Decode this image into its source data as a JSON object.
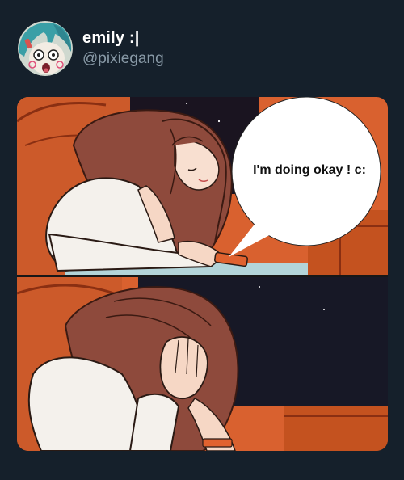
{
  "tweet": {
    "author": {
      "display_name": "emily :|",
      "handle": "@pixiegang",
      "avatar_icon": "shocked-cartoon-avatar-icon"
    },
    "media": {
      "speech_bubble_text": "I'm doing okay ! c:",
      "panels": [
        "girl-typing-on-phone-panel",
        "girl-crying-face-in-hands-panel"
      ]
    }
  },
  "colors": {
    "background": "#15202b",
    "name_text": "#ffffff",
    "handle_text": "#8899a6",
    "wall_orange": "#d9612f",
    "hair_brown": "#8e4a3c"
  }
}
